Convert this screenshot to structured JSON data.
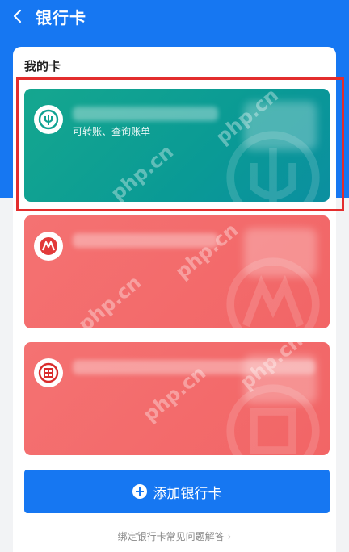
{
  "header": {
    "title": "银行卡"
  },
  "section": {
    "title": "我的卡"
  },
  "cards": [
    {
      "desc": "可转账、查询账单",
      "bank_icon": "abc-bank-icon",
      "color": "#0fa293"
    },
    {
      "desc": "",
      "bank_icon": "cmb-bank-icon",
      "color": "#f46b6b"
    },
    {
      "desc": "",
      "bank_icon": "icbc-bank-icon",
      "color": "#f46b6b"
    }
  ],
  "add_button": {
    "label": "添加银行卡"
  },
  "faq": {
    "label": "绑定银行卡常见问题解答",
    "chevron": "›"
  },
  "watermark": "php.cn",
  "colors": {
    "primary": "#1677f2",
    "highlight": "#e32d2d"
  }
}
